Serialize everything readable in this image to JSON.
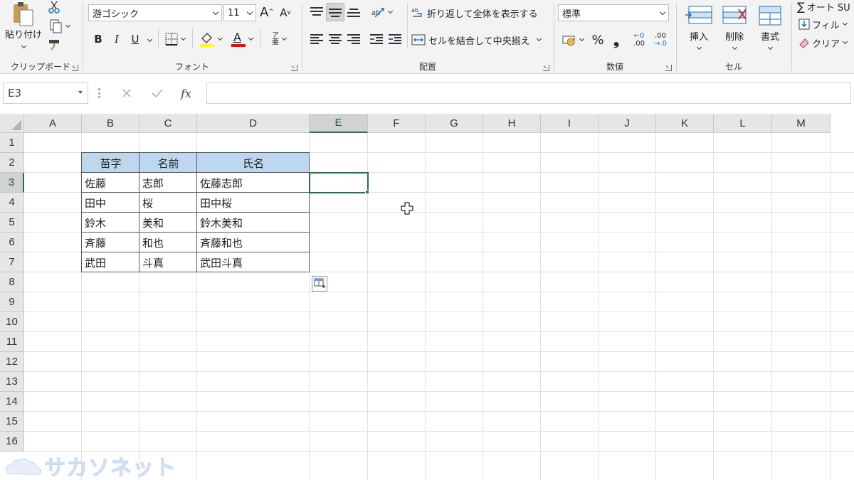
{
  "ribbon": {
    "clipboard": {
      "paste_label": "貼り付け",
      "group_label": "クリップボード"
    },
    "font": {
      "font_name": "游ゴシック",
      "font_size": "11",
      "bold": "B",
      "italic": "I",
      "underline": "U",
      "grow": "A",
      "shrink": "A",
      "font_color_letter": "A",
      "phonetic_top": "ア",
      "phonetic_bottom": "亜",
      "group_label": "フォント",
      "fill_color": "#ffff00",
      "font_color": "#ff0000"
    },
    "alignment": {
      "wrap_text": "折り返して全体を表示する",
      "merge_center": "セルを結合して中央揃え",
      "group_label": "配置"
    },
    "number": {
      "format": "標準",
      "percent": "%",
      "comma": "❟",
      "inc_decimal_top": "←0",
      "inc_decimal_bottom": ".00",
      "dec_decimal_top": ".00",
      "dec_decimal_bottom": "→.0",
      "group_label": "数値"
    },
    "cells": {
      "insert": "挿入",
      "delete": "削除",
      "format": "書式",
      "group_label": "セル"
    },
    "editing": {
      "autosum": "オート SU",
      "fill": "フィル",
      "clear": "クリア"
    }
  },
  "formula_bar": {
    "name_box": "E3",
    "fx": "fx",
    "content": ""
  },
  "columns": [
    "A",
    "B",
    "C",
    "D",
    "E",
    "F",
    "G",
    "H",
    "I",
    "J",
    "K",
    "L",
    "M"
  ],
  "rows": [
    "1",
    "2",
    "3",
    "4",
    "5",
    "6",
    "7",
    "8",
    "9",
    "10",
    "11",
    "12",
    "13",
    "14",
    "15",
    "16"
  ],
  "selected_cell": "E3",
  "table": {
    "headers": [
      "苗字",
      "名前",
      "氏名"
    ],
    "rows": [
      [
        "佐藤",
        "志郎",
        "佐藤志郎"
      ],
      [
        "田中",
        "桜",
        "田中桜"
      ],
      [
        "鈴木",
        "美和",
        "鈴木美和"
      ],
      [
        "斉藤",
        "和也",
        "斉藤和也"
      ],
      [
        "武田",
        "斗真",
        "武田斗真"
      ]
    ],
    "header_fill": "#bdd7ee"
  },
  "accent": "#217346",
  "watermark": "サカソネット"
}
